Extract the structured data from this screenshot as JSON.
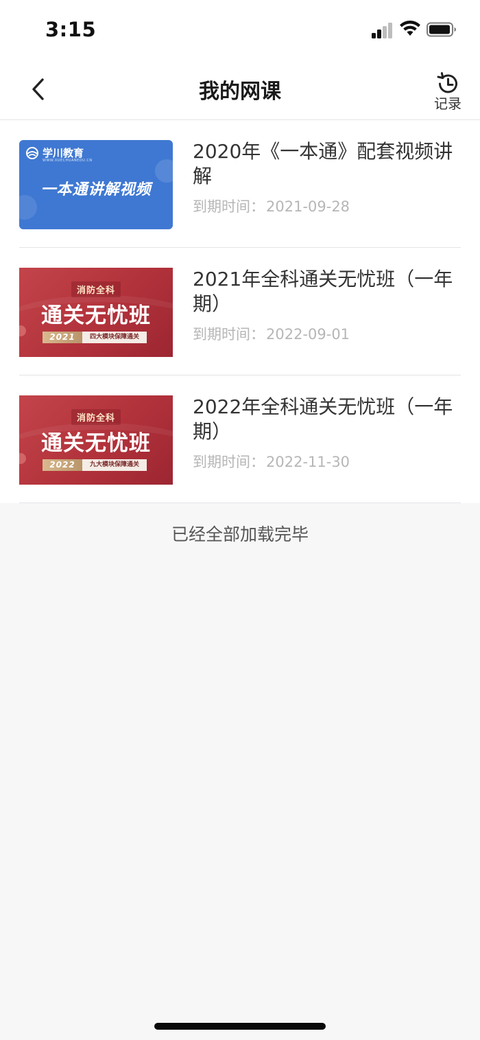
{
  "status_bar": {
    "time": "3:15",
    "icons": [
      "cellular-signal-icon",
      "wifi-icon",
      "battery-icon"
    ]
  },
  "nav": {
    "back_icon": "chevron-left-icon",
    "title": "我的网课",
    "record_icon": "history-clock-icon",
    "record_label": "记录"
  },
  "courses": [
    {
      "title": "2020年《一本通》配套视频讲解",
      "expiry_label": "到期时间：",
      "expiry_date": "2021-09-28",
      "thumbnail": {
        "style": "blue",
        "color": "#3f78d2",
        "brand": "学川教育",
        "brand_sub": "WWW.XUECHUANEDU.CN",
        "headline": "一本通讲解视频"
      }
    },
    {
      "title": "2021年全科通关无忧班（一年期）",
      "expiry_label": "到期时间：",
      "expiry_date": "2022-09-01",
      "thumbnail": {
        "style": "red",
        "color": "#b2323b",
        "tag": "消防全科",
        "headline": "通关无忧班",
        "year": "2021",
        "band_text": "四大模块保障通关"
      }
    },
    {
      "title": "2022年全科通关无忧班（一年期）",
      "expiry_label": "到期时间：",
      "expiry_date": "2022-11-30",
      "thumbnail": {
        "style": "red",
        "color": "#b2323b",
        "tag": "消防全科",
        "headline": "通关无忧班",
        "year": "2022",
        "band_text": "九大模块保障通关"
      }
    }
  ],
  "footer": {
    "loaded_text": "已经全部加载完毕"
  }
}
